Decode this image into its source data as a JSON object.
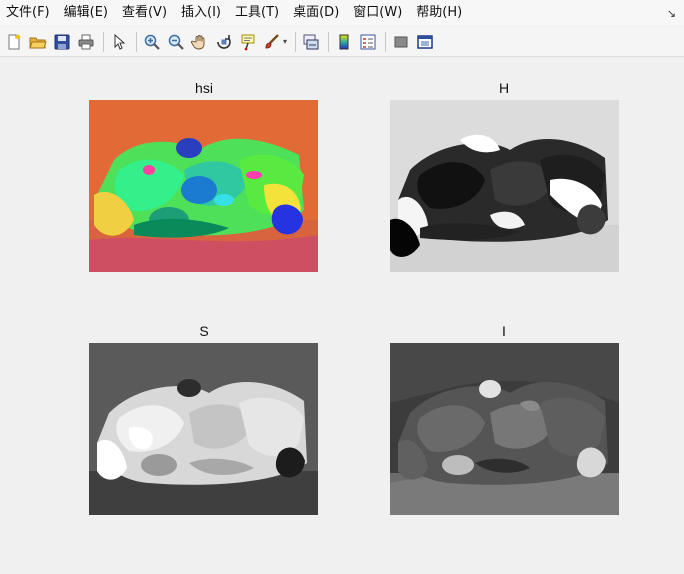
{
  "menu": {
    "items": [
      "文件(F)",
      "编辑(E)",
      "查看(V)",
      "插入(I)",
      "工具(T)",
      "桌面(D)",
      "窗口(W)",
      "帮助(H)"
    ],
    "collapse_glyph": "↘"
  },
  "toolbar": {
    "buttons": [
      {
        "name": "new-figure-icon"
      },
      {
        "name": "open-file-icon"
      },
      {
        "name": "save-icon"
      },
      {
        "name": "print-icon"
      },
      {
        "name": "edit-plot-pointer-icon"
      },
      {
        "name": "zoom-in-icon"
      },
      {
        "name": "zoom-out-icon"
      },
      {
        "name": "pan-hand-icon"
      },
      {
        "name": "rotate-3d-icon"
      },
      {
        "name": "data-cursor-icon"
      },
      {
        "name": "brush-icon"
      },
      {
        "name": "link-plot-icon"
      },
      {
        "name": "insert-colorbar-icon"
      },
      {
        "name": "insert-legend-icon"
      },
      {
        "name": "hide-plot-tools-icon"
      },
      {
        "name": "show-plot-tools-icon"
      }
    ]
  },
  "figure": {
    "subplots": [
      {
        "title": "hsi",
        "kind": "hsi-pseudocolor"
      },
      {
        "title": "H",
        "kind": "hue-channel-grayscale"
      },
      {
        "title": "S",
        "kind": "saturation-channel-grayscale"
      },
      {
        "title": "I",
        "kind": "intensity-channel-grayscale"
      }
    ]
  }
}
